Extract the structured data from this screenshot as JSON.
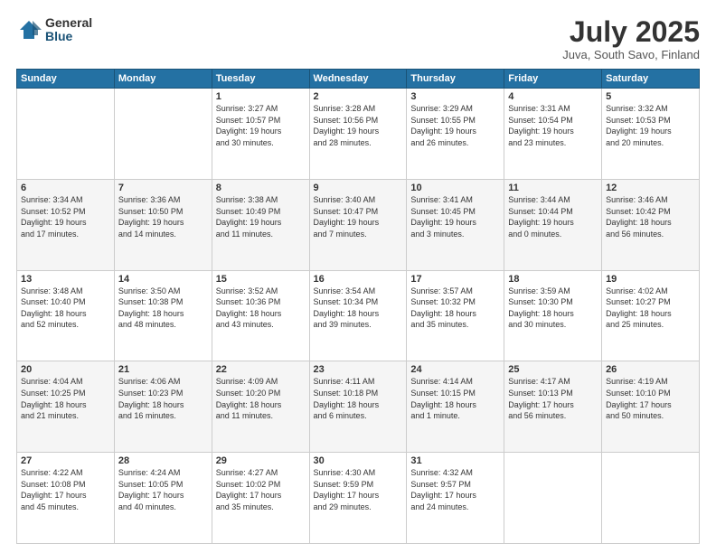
{
  "logo": {
    "general": "General",
    "blue": "Blue"
  },
  "header": {
    "title": "July 2025",
    "subtitle": "Juva, South Savo, Finland"
  },
  "days_header": [
    "Sunday",
    "Monday",
    "Tuesday",
    "Wednesday",
    "Thursday",
    "Friday",
    "Saturday"
  ],
  "weeks": [
    [
      {
        "day": "",
        "info": ""
      },
      {
        "day": "",
        "info": ""
      },
      {
        "day": "1",
        "info": "Sunrise: 3:27 AM\nSunset: 10:57 PM\nDaylight: 19 hours\nand 30 minutes."
      },
      {
        "day": "2",
        "info": "Sunrise: 3:28 AM\nSunset: 10:56 PM\nDaylight: 19 hours\nand 28 minutes."
      },
      {
        "day": "3",
        "info": "Sunrise: 3:29 AM\nSunset: 10:55 PM\nDaylight: 19 hours\nand 26 minutes."
      },
      {
        "day": "4",
        "info": "Sunrise: 3:31 AM\nSunset: 10:54 PM\nDaylight: 19 hours\nand 23 minutes."
      },
      {
        "day": "5",
        "info": "Sunrise: 3:32 AM\nSunset: 10:53 PM\nDaylight: 19 hours\nand 20 minutes."
      }
    ],
    [
      {
        "day": "6",
        "info": "Sunrise: 3:34 AM\nSunset: 10:52 PM\nDaylight: 19 hours\nand 17 minutes."
      },
      {
        "day": "7",
        "info": "Sunrise: 3:36 AM\nSunset: 10:50 PM\nDaylight: 19 hours\nand 14 minutes."
      },
      {
        "day": "8",
        "info": "Sunrise: 3:38 AM\nSunset: 10:49 PM\nDaylight: 19 hours\nand 11 minutes."
      },
      {
        "day": "9",
        "info": "Sunrise: 3:40 AM\nSunset: 10:47 PM\nDaylight: 19 hours\nand 7 minutes."
      },
      {
        "day": "10",
        "info": "Sunrise: 3:41 AM\nSunset: 10:45 PM\nDaylight: 19 hours\nand 3 minutes."
      },
      {
        "day": "11",
        "info": "Sunrise: 3:44 AM\nSunset: 10:44 PM\nDaylight: 19 hours\nand 0 minutes."
      },
      {
        "day": "12",
        "info": "Sunrise: 3:46 AM\nSunset: 10:42 PM\nDaylight: 18 hours\nand 56 minutes."
      }
    ],
    [
      {
        "day": "13",
        "info": "Sunrise: 3:48 AM\nSunset: 10:40 PM\nDaylight: 18 hours\nand 52 minutes."
      },
      {
        "day": "14",
        "info": "Sunrise: 3:50 AM\nSunset: 10:38 PM\nDaylight: 18 hours\nand 48 minutes."
      },
      {
        "day": "15",
        "info": "Sunrise: 3:52 AM\nSunset: 10:36 PM\nDaylight: 18 hours\nand 43 minutes."
      },
      {
        "day": "16",
        "info": "Sunrise: 3:54 AM\nSunset: 10:34 PM\nDaylight: 18 hours\nand 39 minutes."
      },
      {
        "day": "17",
        "info": "Sunrise: 3:57 AM\nSunset: 10:32 PM\nDaylight: 18 hours\nand 35 minutes."
      },
      {
        "day": "18",
        "info": "Sunrise: 3:59 AM\nSunset: 10:30 PM\nDaylight: 18 hours\nand 30 minutes."
      },
      {
        "day": "19",
        "info": "Sunrise: 4:02 AM\nSunset: 10:27 PM\nDaylight: 18 hours\nand 25 minutes."
      }
    ],
    [
      {
        "day": "20",
        "info": "Sunrise: 4:04 AM\nSunset: 10:25 PM\nDaylight: 18 hours\nand 21 minutes."
      },
      {
        "day": "21",
        "info": "Sunrise: 4:06 AM\nSunset: 10:23 PM\nDaylight: 18 hours\nand 16 minutes."
      },
      {
        "day": "22",
        "info": "Sunrise: 4:09 AM\nSunset: 10:20 PM\nDaylight: 18 hours\nand 11 minutes."
      },
      {
        "day": "23",
        "info": "Sunrise: 4:11 AM\nSunset: 10:18 PM\nDaylight: 18 hours\nand 6 minutes."
      },
      {
        "day": "24",
        "info": "Sunrise: 4:14 AM\nSunset: 10:15 PM\nDaylight: 18 hours\nand 1 minute."
      },
      {
        "day": "25",
        "info": "Sunrise: 4:17 AM\nSunset: 10:13 PM\nDaylight: 17 hours\nand 56 minutes."
      },
      {
        "day": "26",
        "info": "Sunrise: 4:19 AM\nSunset: 10:10 PM\nDaylight: 17 hours\nand 50 minutes."
      }
    ],
    [
      {
        "day": "27",
        "info": "Sunrise: 4:22 AM\nSunset: 10:08 PM\nDaylight: 17 hours\nand 45 minutes."
      },
      {
        "day": "28",
        "info": "Sunrise: 4:24 AM\nSunset: 10:05 PM\nDaylight: 17 hours\nand 40 minutes."
      },
      {
        "day": "29",
        "info": "Sunrise: 4:27 AM\nSunset: 10:02 PM\nDaylight: 17 hours\nand 35 minutes."
      },
      {
        "day": "30",
        "info": "Sunrise: 4:30 AM\nSunset: 9:59 PM\nDaylight: 17 hours\nand 29 minutes."
      },
      {
        "day": "31",
        "info": "Sunrise: 4:32 AM\nSunset: 9:57 PM\nDaylight: 17 hours\nand 24 minutes."
      },
      {
        "day": "",
        "info": ""
      },
      {
        "day": "",
        "info": ""
      }
    ]
  ]
}
